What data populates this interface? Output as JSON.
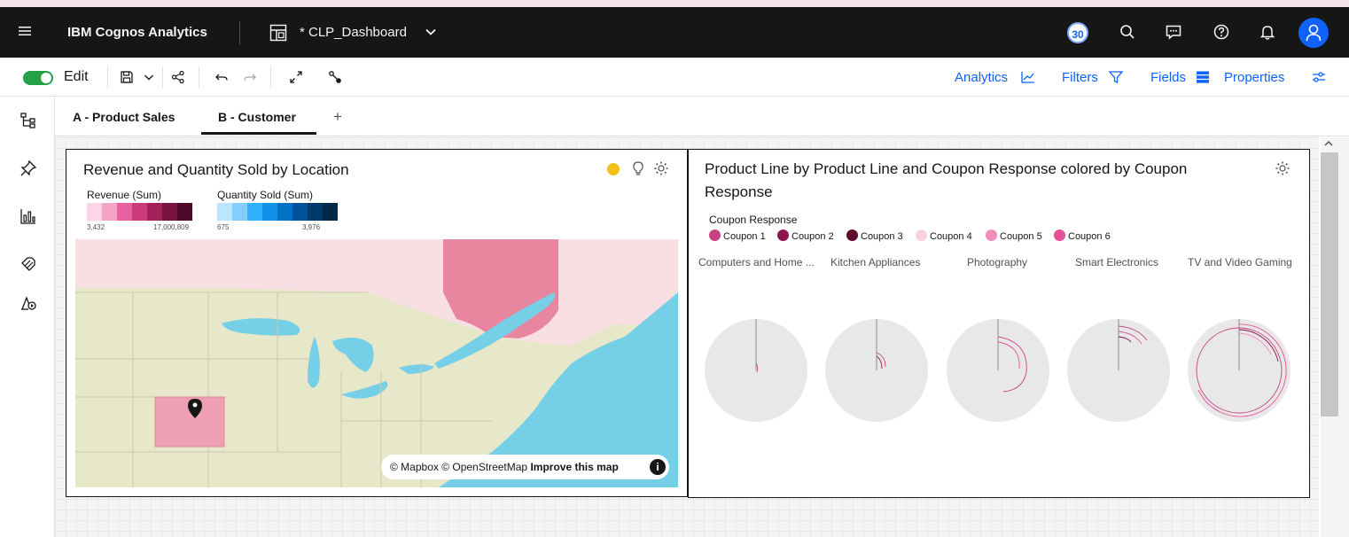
{
  "header": {
    "brand": "IBM Cognos Analytics",
    "dashboard_title": "* CLP_Dashboard",
    "notification_count": "30"
  },
  "toolbar": {
    "edit_label": "Edit",
    "edit_enabled": true,
    "analytics_label": "Analytics",
    "filters_label": "Filters",
    "fields_label": "Fields",
    "properties_label": "Properties"
  },
  "tabs": [
    {
      "label": "A - Product Sales",
      "selected": false
    },
    {
      "label": "B - Customer",
      "selected": true
    }
  ],
  "tab_add": "+",
  "widget1": {
    "title": "Revenue and Quantity Sold by Location",
    "legend_revenue_label": "Revenue (Sum)",
    "legend_revenue_min": "3,432",
    "legend_revenue_max": "17,000,809",
    "legend_quantity_label": "Quantity Sold (Sum)",
    "legend_quantity_min": "675",
    "legend_quantity_max": "3,976",
    "revenue_colors": [
      "#fcd6e6",
      "#f5a3c7",
      "#e8609e",
      "#c93a78",
      "#a3215b",
      "#7a1240",
      "#4e0a29"
    ],
    "quantity_colors": [
      "#bae6ff",
      "#82cfff",
      "#33b1ff",
      "#1192e8",
      "#0072c3",
      "#00539a",
      "#003a6d",
      "#012749"
    ],
    "attribution_prefix": "© Mapbox © OpenStreetMap",
    "attribution_link": "Improve this map",
    "info_glyph": "i"
  },
  "widget2": {
    "title": "Product Line by Product Line and Coupon Response colored by Coupon Response",
    "legend_title": "Coupon Response",
    "legend_items": [
      {
        "label": "Coupon 1",
        "color": "#c94384"
      },
      {
        "label": "Coupon 2",
        "color": "#8e1551"
      },
      {
        "label": "Coupon 3",
        "color": "#5e0b30"
      },
      {
        "label": "Coupon 4",
        "color": "#fad1e3"
      },
      {
        "label": "Coupon 5",
        "color": "#f28cbb"
      },
      {
        "label": "Coupon 6",
        "color": "#e64f98"
      }
    ],
    "columns": [
      "Computers and Home ...",
      "Kitchen Appliances",
      "Photography",
      "Smart Electronics",
      "TV and Video Gaming"
    ]
  },
  "icons": {
    "menu": "hamburger-icon",
    "search": "search-icon",
    "chat": "chat-icon",
    "help": "help-icon",
    "notifications": "bell-icon",
    "user": "user-icon"
  },
  "colors": {
    "accent": "#0f62fe",
    "warning": "#f1c21b",
    "toggle": "#24a148"
  }
}
